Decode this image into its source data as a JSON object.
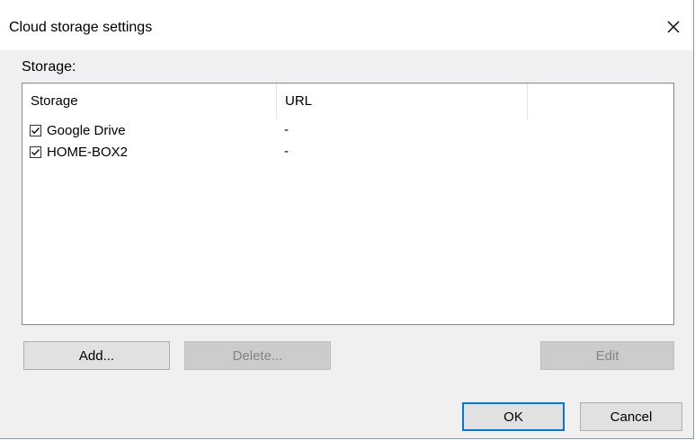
{
  "dialog": {
    "title": "Cloud storage settings",
    "close_icon": "close-icon"
  },
  "storage_section": {
    "label": "Storage:"
  },
  "list": {
    "columns": [
      {
        "label": "Storage"
      },
      {
        "label": "URL"
      },
      {
        "label": ""
      }
    ],
    "rows": [
      {
        "name": "Google Drive",
        "url": "-",
        "checked": true
      },
      {
        "name": "HOME-BOX2",
        "url": "-",
        "checked": true
      }
    ]
  },
  "buttons": {
    "add": "Add...",
    "delete": "Delete...",
    "edit": "Edit",
    "ok": "OK",
    "cancel": "Cancel"
  }
}
